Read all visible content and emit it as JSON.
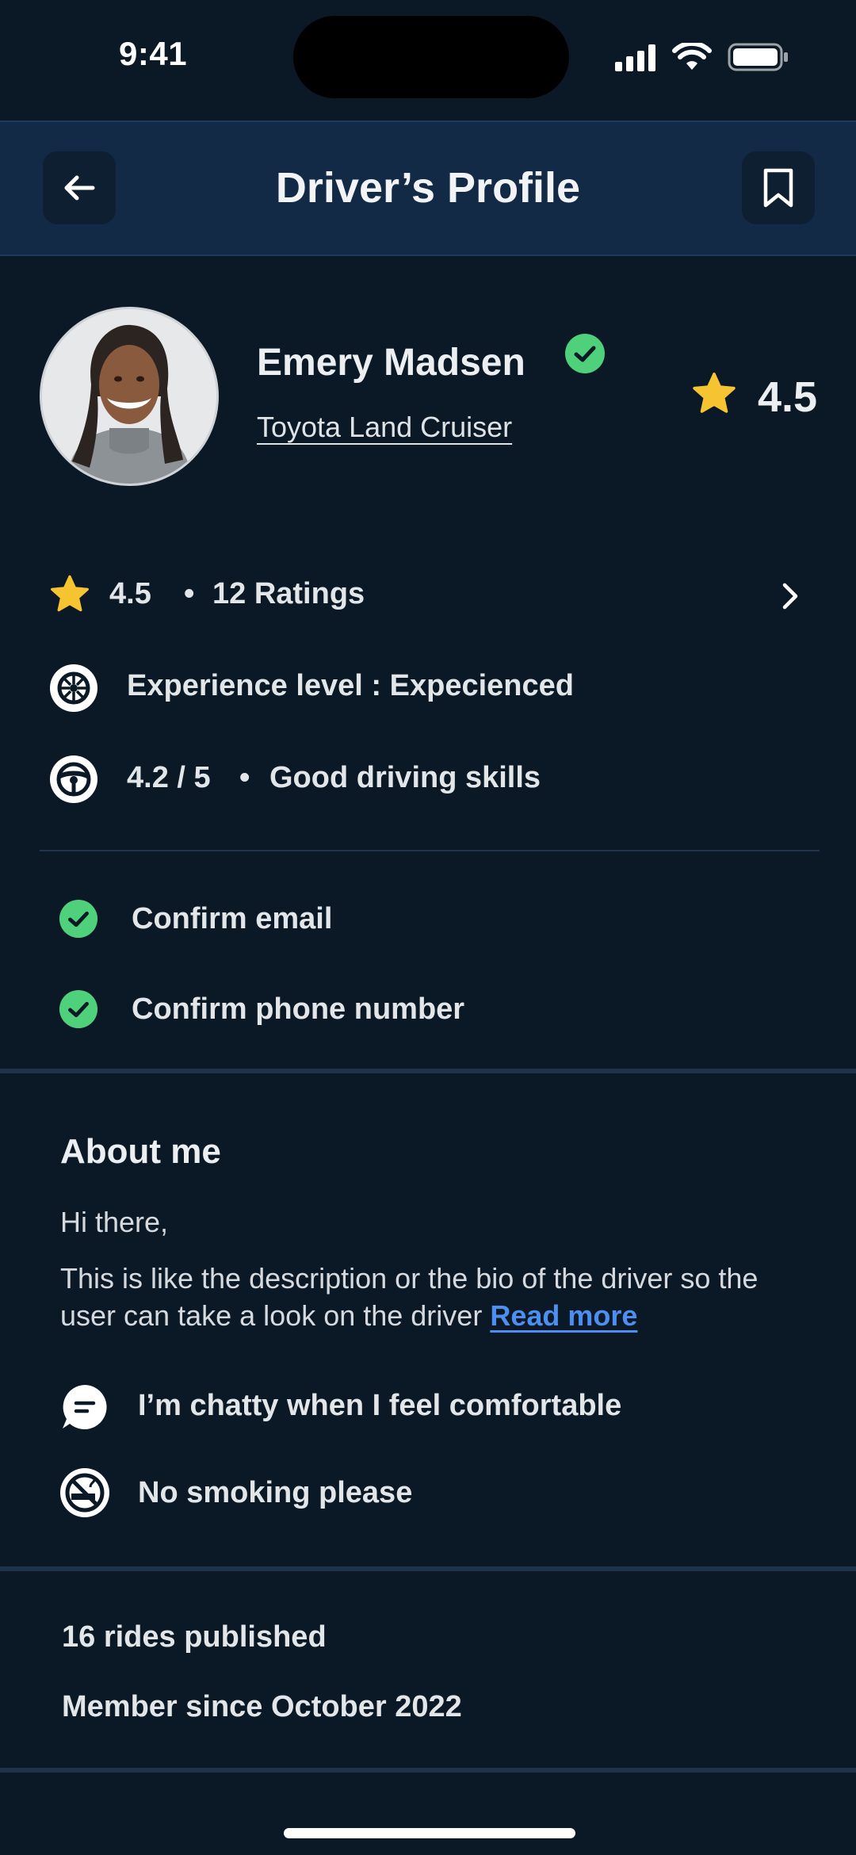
{
  "status_bar": {
    "time": "9:41"
  },
  "header": {
    "title": "Driver’s Profile"
  },
  "driver": {
    "name": "Emery Madsen",
    "car": "Toyota Land Cruiser",
    "rating": "4.5"
  },
  "stats": {
    "rating": "4.5",
    "ratings_count": "12 Ratings",
    "experience": "Experience level : Expecienced",
    "driving_score": "4.2 / 5",
    "driving_label": "Good driving skills"
  },
  "verifications": [
    {
      "label": "Confirm email"
    },
    {
      "label": "Confirm phone number"
    }
  ],
  "about": {
    "title": "About me",
    "greeting": "Hi there,",
    "bio": "This is like the description or the bio of the driver so the user can take a look on the driver",
    "read_more": "Read more",
    "prefs": [
      {
        "label": "I’m chatty when I feel comfortable",
        "icon": "chat-icon"
      },
      {
        "label": "No smoking please",
        "icon": "no-smoking-icon"
      }
    ]
  },
  "activity": {
    "rides": "16 rides published",
    "member_since": "Member since October 2022"
  },
  "colors": {
    "background": "#0b1926",
    "header": "#122a45",
    "star": "#f6c431",
    "verified": "#4fd07a",
    "link": "#4d8ff0"
  }
}
